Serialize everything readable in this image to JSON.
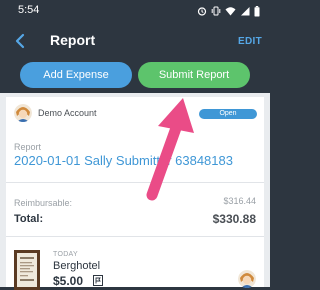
{
  "status_bar": {
    "time": "5:54",
    "icons": [
      "alarm-icon",
      "vibrate-icon",
      "wifi-icon",
      "cell-signal-icon",
      "battery-icon"
    ]
  },
  "header": {
    "title": "Report",
    "back_icon": "chevron-left-icon",
    "edit_label": "EDIT"
  },
  "actions": {
    "add_expense_label": "Add Expense",
    "submit_report_label": "Submit Report"
  },
  "report": {
    "account_name": "Demo Account",
    "status": "Open",
    "report_label": "Report",
    "report_name": "2020-01-01 Sally Submitter 63848183",
    "reimbursable_label": "Reimbursable:",
    "reimbursable_value": "$316.44",
    "total_label": "Total:",
    "total_value": "$330.88"
  },
  "expenses": [
    {
      "date": "TODAY",
      "merchant": "Berghotel",
      "amount": "$5.00"
    }
  ],
  "colors": {
    "header_bg": "#2d3640",
    "accent_blue": "#4a9fde",
    "accent_green": "#5dc46c",
    "link_blue": "#3f97d6",
    "annotation_arrow": "#ea4c87"
  }
}
